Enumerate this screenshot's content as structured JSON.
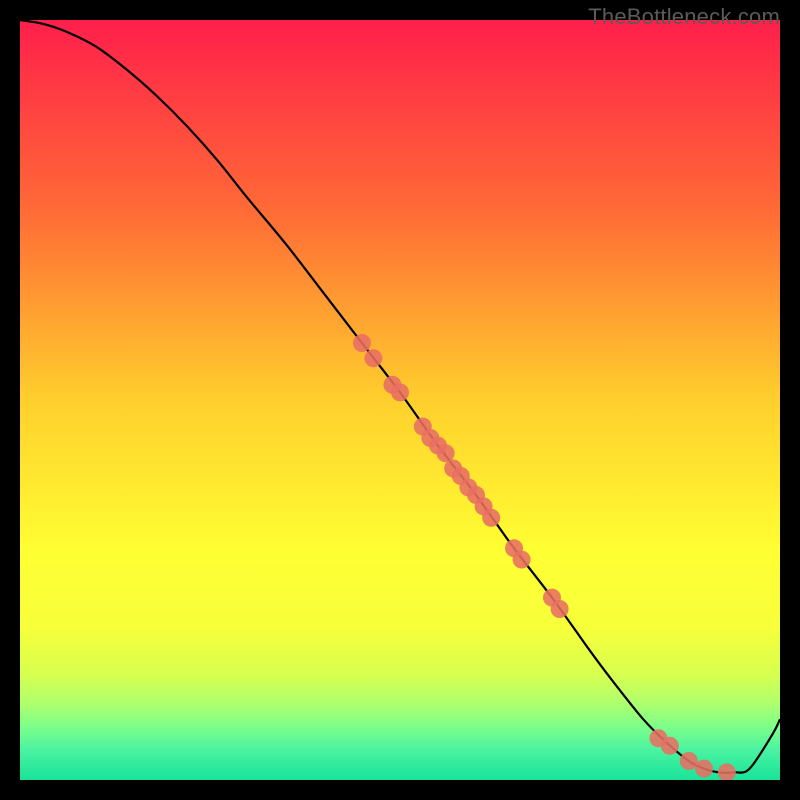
{
  "watermark": "TheBottleneck.com",
  "chart_data": {
    "type": "line",
    "title": "",
    "xlabel": "",
    "ylabel": "",
    "xlim": [
      0,
      100
    ],
    "ylim": [
      0,
      100
    ],
    "grid": false,
    "series": [
      {
        "name": "curve",
        "color": "#000000",
        "x": [
          0,
          3,
          6,
          10,
          14,
          18,
          22,
          26,
          30,
          35,
          40,
          45,
          50,
          55,
          60,
          65,
          70,
          75,
          78,
          82,
          85,
          88,
          90,
          92,
          94,
          96,
          99,
          100
        ],
        "y": [
          100,
          99.5,
          98.5,
          96.5,
          93.5,
          90,
          86,
          81.5,
          76.5,
          70.5,
          64,
          57.5,
          51,
          44,
          37.5,
          30.5,
          24,
          17,
          13,
          8,
          5,
          2.5,
          1.5,
          1,
          1,
          1.5,
          6,
          8
        ]
      }
    ],
    "scatter": {
      "name": "markers",
      "color": "#e86e63",
      "radius": 9,
      "points": [
        {
          "x": 45,
          "y": 57.5
        },
        {
          "x": 46.5,
          "y": 55.5
        },
        {
          "x": 49,
          "y": 52
        },
        {
          "x": 50,
          "y": 51
        },
        {
          "x": 53,
          "y": 46.5
        },
        {
          "x": 54,
          "y": 45
        },
        {
          "x": 55,
          "y": 44
        },
        {
          "x": 56,
          "y": 43
        },
        {
          "x": 57,
          "y": 41
        },
        {
          "x": 58,
          "y": 40
        },
        {
          "x": 59,
          "y": 38.5
        },
        {
          "x": 60,
          "y": 37.5
        },
        {
          "x": 61,
          "y": 36
        },
        {
          "x": 62,
          "y": 34.5
        },
        {
          "x": 65,
          "y": 30.5
        },
        {
          "x": 66,
          "y": 29
        },
        {
          "x": 70,
          "y": 24
        },
        {
          "x": 71,
          "y": 22.5
        },
        {
          "x": 84,
          "y": 5.5
        },
        {
          "x": 85.5,
          "y": 4.5
        },
        {
          "x": 88,
          "y": 2.5
        },
        {
          "x": 90,
          "y": 1.5
        },
        {
          "x": 93,
          "y": 1
        }
      ]
    },
    "gradient_stops": [
      {
        "offset": 0.0,
        "color": "#ff1f4b"
      },
      {
        "offset": 0.25,
        "color": "#ff6a36"
      },
      {
        "offset": 0.5,
        "color": "#ffcf2d"
      },
      {
        "offset": 0.7,
        "color": "#ffff33"
      },
      {
        "offset": 0.8,
        "color": "#f6ff3a"
      },
      {
        "offset": 0.86,
        "color": "#d8ff4f"
      },
      {
        "offset": 0.9,
        "color": "#adff6e"
      },
      {
        "offset": 0.93,
        "color": "#7cff8a"
      },
      {
        "offset": 0.96,
        "color": "#4bf3a0"
      },
      {
        "offset": 1.0,
        "color": "#18e39a"
      }
    ]
  }
}
